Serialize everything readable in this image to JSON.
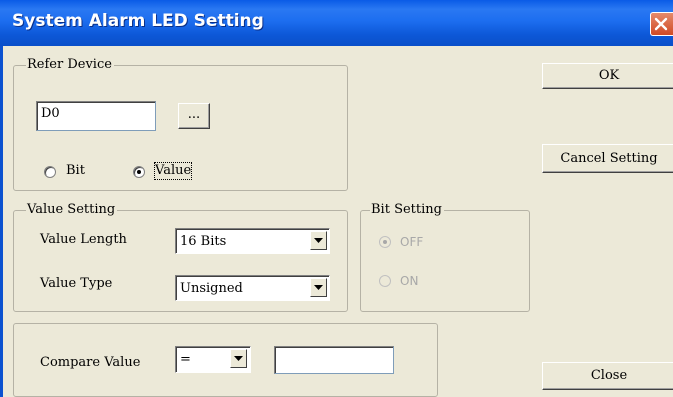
{
  "window": {
    "title": "System Alarm LED Setting"
  },
  "refer_device": {
    "legend": "Refer Device",
    "device_value": "D0",
    "browse_label": "...",
    "bit_label": "Bit",
    "value_label": "Value",
    "selected": "Value"
  },
  "value_setting": {
    "legend": "Value Setting",
    "length_label": "Value Length",
    "length_value": "16 Bits",
    "type_label": "Value Type",
    "type_value": "Unsigned"
  },
  "bit_setting": {
    "legend": "Bit Setting",
    "off_label": "OFF",
    "on_label": "ON",
    "selected": "OFF",
    "enabled": false
  },
  "compare": {
    "label": "Compare Value",
    "operator": "=",
    "value": ""
  },
  "buttons": {
    "ok": "OK",
    "cancel": "Cancel Setting",
    "close": "Close"
  }
}
